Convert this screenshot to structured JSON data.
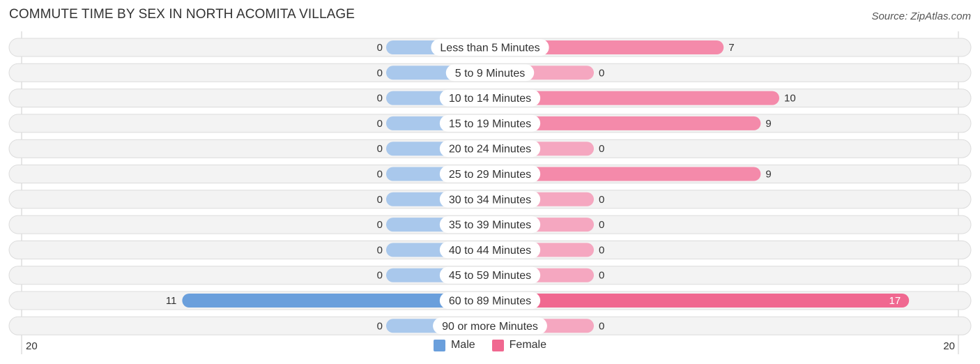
{
  "header": {
    "title": "COMMUTE TIME BY SEX IN NORTH ACOMITA VILLAGE",
    "source": "Source: ZipAtlas.com"
  },
  "colors": {
    "male": "#6a9fdc",
    "male_light": "#a9c8ec",
    "female": "#f06890",
    "female_light": "#f5a7c0",
    "female_mid": "#f48aaa"
  },
  "chart_data": {
    "type": "bar",
    "orientation": "horizontal-diverging",
    "title": "COMMUTE TIME BY SEX IN NORTH ACOMITA VILLAGE",
    "categories": [
      "Less than 5 Minutes",
      "5 to 9 Minutes",
      "10 to 14 Minutes",
      "15 to 19 Minutes",
      "20 to 24 Minutes",
      "25 to 29 Minutes",
      "30 to 34 Minutes",
      "35 to 39 Minutes",
      "40 to 44 Minutes",
      "45 to 59 Minutes",
      "60 to 89 Minutes",
      "90 or more Minutes"
    ],
    "series": [
      {
        "name": "Male",
        "values": [
          0,
          0,
          0,
          0,
          0,
          0,
          0,
          0,
          0,
          0,
          11,
          0
        ]
      },
      {
        "name": "Female",
        "values": [
          7,
          0,
          10,
          9,
          0,
          9,
          0,
          0,
          0,
          0,
          17,
          0
        ]
      }
    ],
    "xlim": [
      -20,
      20
    ],
    "axis_labels": {
      "left": "20",
      "right": "20"
    },
    "legend": {
      "position": "bottom-center",
      "entries": [
        "Male",
        "Female"
      ]
    },
    "grid": false
  }
}
